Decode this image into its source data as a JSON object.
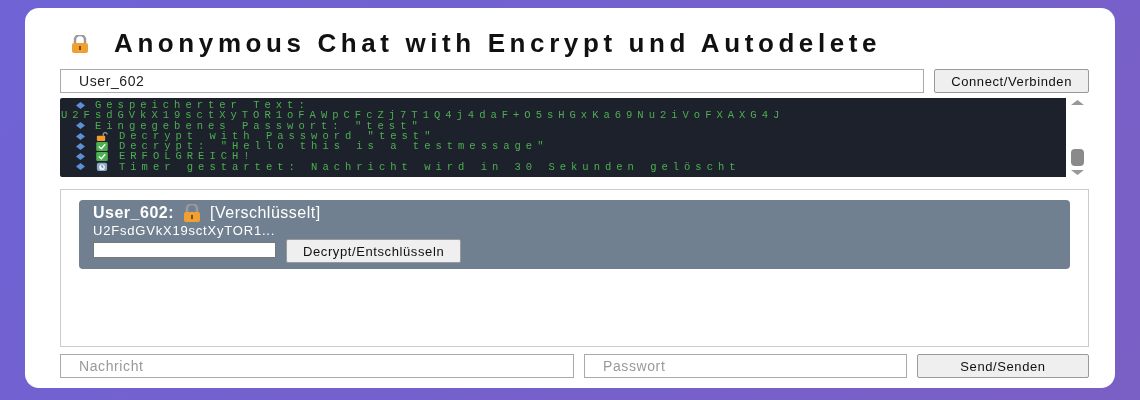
{
  "title": "Anonymous Chat with Encrypt und Autodelete",
  "connect": {
    "username": "User_602",
    "button": "Connect/Verbinden"
  },
  "log": [
    {
      "kind": "info",
      "text": "Gespeicherter Text:"
    },
    {
      "kind": "wrap",
      "text": "U2FsdGVkX19sctXyTOR1oFAWpCFcZj7T1Q4j4daF+O5sHGxKa69Nu2iVoFXAXG4J"
    },
    {
      "kind": "info",
      "text": "Eingegebenes Passwort: \"test\""
    },
    {
      "kind": "unlock",
      "text": "Decrypt with Password \"test\""
    },
    {
      "kind": "success",
      "text": "Decrypt: \"Hello this is a testmessage\""
    },
    {
      "kind": "success",
      "text": "ERFOLGREICH!"
    },
    {
      "kind": "timer",
      "text": "Timer gestartet: Nachricht wird in 30 Sekunden gelöscht"
    }
  ],
  "messages": [
    {
      "user": "User_602:",
      "status": "[Verschlüsselt]",
      "preview": "U2FsdGVkX19sctXyTOR1...",
      "button": "Decrypt/Entschlüsseln"
    }
  ],
  "composer": {
    "message_placeholder": "Nachricht",
    "password_placeholder": "Passwort",
    "button": "Send/Senden"
  }
}
